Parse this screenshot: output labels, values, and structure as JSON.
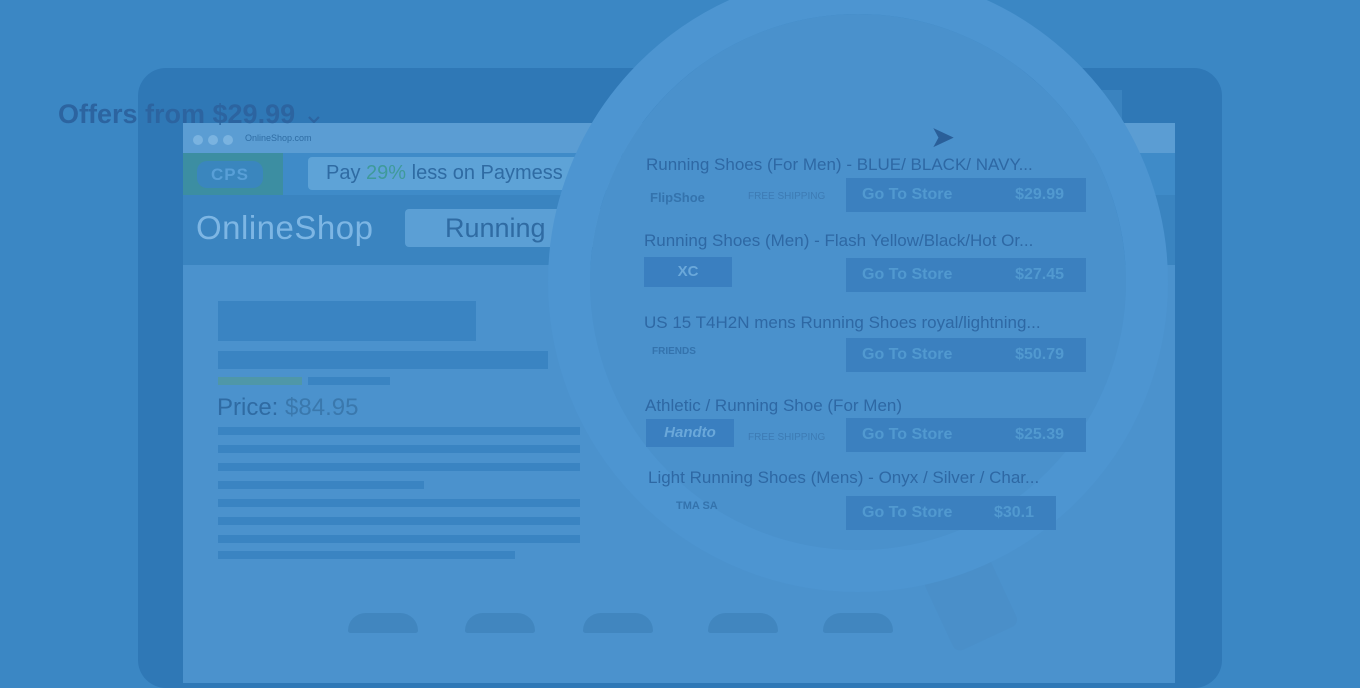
{
  "browser": {
    "url": "OnlineShop.com"
  },
  "banner": {
    "logo": "CPS",
    "pay_prefix": "Pay",
    "pay_percent": "29%",
    "pay_suffix": "less on Paymess"
  },
  "shop": {
    "logo": "OnlineShop",
    "search_value": "Running"
  },
  "product": {
    "price_label": "Price:",
    "price_value": "$84.95"
  },
  "offers": {
    "heading": "Offers from $29.99",
    "items": [
      {
        "title": "Running Shoes (For Men) - BLUE/ BLACK/ NAVY...",
        "store": "FlipShoe",
        "shipping": "FREE SHIPPING",
        "button": "Go To Store",
        "price": "$29.99"
      },
      {
        "title": "Running Shoes (Men) - Flash Yellow/Black/Hot Or...",
        "store": "XC",
        "shipping": "",
        "button": "Go To Store",
        "price": "$27.45"
      },
      {
        "title": "US 15 T4H2N mens Running Shoes royal/lightning...",
        "store": "FRIENDS",
        "shipping": "",
        "button": "Go To Store",
        "price": "$50.79"
      },
      {
        "title": "Athletic / Running Shoe (For Men)",
        "store": "Handto",
        "shipping": "FREE SHIPPING",
        "button": "Go To Store",
        "price": "$25.39"
      },
      {
        "title": "Light Running Shoes (Mens) - Onyx / Silver / Char...",
        "store": "TMA SA",
        "shipping": "",
        "button": "Go To Store",
        "price": "$30.1"
      }
    ]
  },
  "icons": {
    "chevron": "chevron-down-icon",
    "cursor": "cursor-arrow-icon"
  }
}
